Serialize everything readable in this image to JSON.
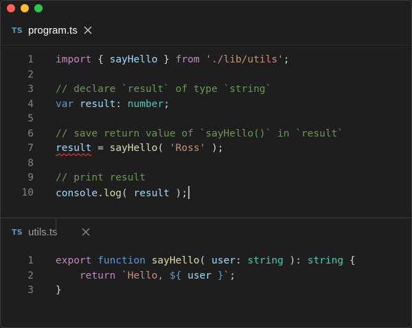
{
  "window": {
    "traffic_lights": [
      "close",
      "minimize",
      "maximize"
    ]
  },
  "editor1": {
    "tab": {
      "badge": "TS",
      "name": "program.ts",
      "active": true,
      "icon": "close-icon"
    },
    "line_numbers": [
      "1",
      "2",
      "3",
      "4",
      "5",
      "6",
      "7",
      "8",
      "9",
      "10"
    ],
    "lines": [
      [
        {
          "t": "import",
          "c": "kw-import"
        },
        {
          "t": " { ",
          "c": "punc"
        },
        {
          "t": "sayHello",
          "c": "var"
        },
        {
          "t": " } ",
          "c": "punc"
        },
        {
          "t": "from",
          "c": "kw-import"
        },
        {
          "t": " ",
          "c": "punc"
        },
        {
          "t": "'./lib/utils'",
          "c": "str"
        },
        {
          "t": ";",
          "c": "punc"
        }
      ],
      [],
      [
        {
          "t": "// declare `result` of type `string`",
          "c": "cmt"
        }
      ],
      [
        {
          "t": "var",
          "c": "kw"
        },
        {
          "t": " ",
          "c": "punc"
        },
        {
          "t": "result",
          "c": "var"
        },
        {
          "t": ": ",
          "c": "punc"
        },
        {
          "t": "number",
          "c": "type"
        },
        {
          "t": ";",
          "c": "punc"
        }
      ],
      [],
      [
        {
          "t": "// save return value of `sayHello()` in `result`",
          "c": "cmt"
        }
      ],
      [
        {
          "t": "result",
          "c": "var squiggle"
        },
        {
          "t": " = ",
          "c": "punc"
        },
        {
          "t": "sayHello",
          "c": "fn"
        },
        {
          "t": "( ",
          "c": "punc"
        },
        {
          "t": "'Ross'",
          "c": "str"
        },
        {
          "t": " );",
          "c": "punc"
        }
      ],
      [],
      [
        {
          "t": "// print result",
          "c": "cmt"
        }
      ],
      [
        {
          "t": "console",
          "c": "var"
        },
        {
          "t": ".",
          "c": "punc"
        },
        {
          "t": "log",
          "c": "fn"
        },
        {
          "t": "( ",
          "c": "punc"
        },
        {
          "t": "result",
          "c": "var"
        },
        {
          "t": " );",
          "c": "punc"
        }
      ]
    ],
    "cursor_line": 10
  },
  "editor2": {
    "tab": {
      "badge": "TS",
      "name": "utils.ts",
      "active": false,
      "icon": "close-icon"
    },
    "line_numbers": [
      "1",
      "2",
      "3"
    ],
    "lines": [
      [
        {
          "t": "export",
          "c": "kw-import"
        },
        {
          "t": " ",
          "c": "punc"
        },
        {
          "t": "function",
          "c": "kw"
        },
        {
          "t": " ",
          "c": "punc"
        },
        {
          "t": "sayHello",
          "c": "fn"
        },
        {
          "t": "( ",
          "c": "punc"
        },
        {
          "t": "user",
          "c": "var"
        },
        {
          "t": ": ",
          "c": "punc"
        },
        {
          "t": "string",
          "c": "type"
        },
        {
          "t": " ): ",
          "c": "punc"
        },
        {
          "t": "string",
          "c": "type"
        },
        {
          "t": " {",
          "c": "punc"
        }
      ],
      [
        {
          "t": "    ",
          "c": "punc"
        },
        {
          "t": "return",
          "c": "kw-import"
        },
        {
          "t": " ",
          "c": "punc"
        },
        {
          "t": "`Hello, ",
          "c": "str"
        },
        {
          "t": "${",
          "c": "tmpl"
        },
        {
          "t": " ",
          "c": "punc"
        },
        {
          "t": "user",
          "c": "var"
        },
        {
          "t": " ",
          "c": "punc"
        },
        {
          "t": "}",
          "c": "tmpl"
        },
        {
          "t": "`",
          "c": "str"
        },
        {
          "t": ";",
          "c": "punc"
        }
      ],
      [
        {
          "t": "}",
          "c": "punc"
        }
      ]
    ],
    "indent_guide_line": 2
  }
}
